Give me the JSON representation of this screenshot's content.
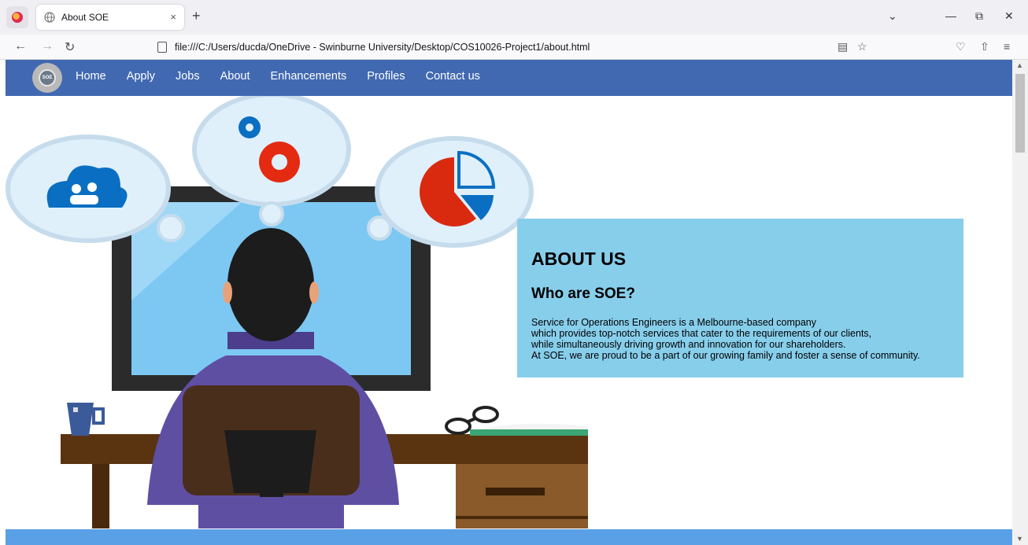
{
  "browser": {
    "tab_title": "About SOE",
    "tab_close": "×",
    "new_tab": "+",
    "url": "file:///C:/Users/ducda/OneDrive - Swinburne University/Desktop/COS10026-Project1/about.html",
    "window_controls": {
      "chevron": "⌄",
      "minimize": "—",
      "restore": "⧉",
      "close": "✕"
    },
    "nav": {
      "back": "←",
      "forward": "→",
      "reload": "↻"
    },
    "toolbar_icons": {
      "reader": "▤",
      "bookmark": "☆",
      "pocket": "♡",
      "extensions": "⇧",
      "menu": "≡"
    }
  },
  "site": {
    "logo_text": "SOE",
    "menu": [
      {
        "label": "Home"
      },
      {
        "label": "Apply"
      },
      {
        "label": "Jobs"
      },
      {
        "label": "About"
      },
      {
        "label": "Enhancements"
      },
      {
        "label": "Profiles"
      },
      {
        "label": "Contact us"
      }
    ],
    "about": {
      "heading": "ABOUT US",
      "subheading": "Who are SOE?",
      "lines": [
        "Service for Operations Engineers is a Melbourne-based company",
        "which provides top-notch services that cater to the requirements of our clients,",
        "while simultaneously driving growth and innovation for our shareholders.",
        "At SOE, we are proud to be a part of our growing family and foster a sense of community."
      ]
    }
  },
  "colors": {
    "nav_bg": "#4169b1",
    "about_bg": "#87ceeb",
    "footer_bg": "#5aa0e6"
  }
}
